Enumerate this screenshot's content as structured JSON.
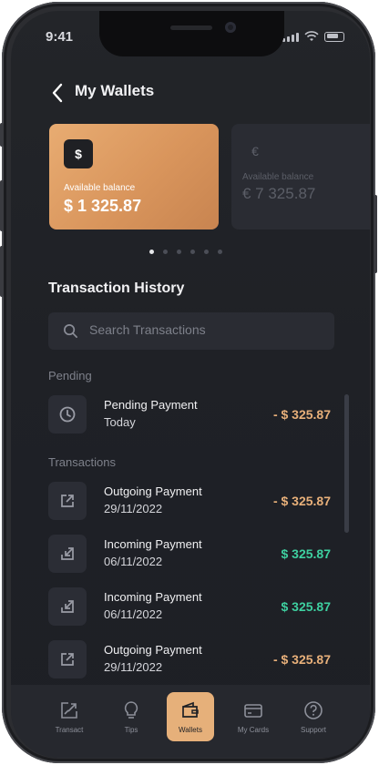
{
  "status_bar": {
    "time": "9:41"
  },
  "header": {
    "title": "My Wallets"
  },
  "wallets": [
    {
      "currency_symbol": "$",
      "balance_label": "Available balance",
      "balance": "$ 1 325.87"
    },
    {
      "currency_symbol": "€",
      "balance_label": "Available balance",
      "balance": "€ 7 325.87"
    }
  ],
  "carousel": {
    "pages": 6,
    "active_index": 0
  },
  "transactions_section": {
    "title": "Transaction History",
    "search_placeholder": "Search Transactions",
    "pending_label": "Pending",
    "transactions_label": "Transactions",
    "pending": [
      {
        "title": "Pending Payment",
        "date": "Today",
        "amount": "- $ 325.87",
        "icon": "clock-icon"
      }
    ],
    "items": [
      {
        "title": "Outgoing Payment",
        "date": "29/11/2022",
        "amount": "- $ 325.87",
        "type": "outgoing",
        "icon": "arrow-up-right-icon"
      },
      {
        "title": "Incoming Payment",
        "date": "06/11/2022",
        "amount": "$ 325.87",
        "type": "incoming",
        "icon": "arrow-down-left-icon"
      },
      {
        "title": "Incoming Payment",
        "date": "06/11/2022",
        "amount": "$ 325.87",
        "type": "incoming",
        "icon": "arrow-down-left-icon"
      },
      {
        "title": "Outgoing Payment",
        "date": "29/11/2022",
        "amount": "- $ 325.87",
        "type": "outgoing",
        "icon": "arrow-up-right-icon"
      }
    ]
  },
  "tabbar": {
    "tabs": [
      {
        "label": "Transact",
        "icon": "transfer-icon"
      },
      {
        "label": "Tips",
        "icon": "lightbulb-icon"
      },
      {
        "label": "Wallets",
        "icon": "wallet-icon",
        "active": true
      },
      {
        "label": "My Cards",
        "icon": "credit-card-icon"
      },
      {
        "label": "Support",
        "icon": "help-icon"
      }
    ]
  },
  "colors": {
    "accent": "#e6b07a",
    "negative_amount": "#e8b07a",
    "positive_amount": "#3ed0a0",
    "background": "#1f2126"
  }
}
